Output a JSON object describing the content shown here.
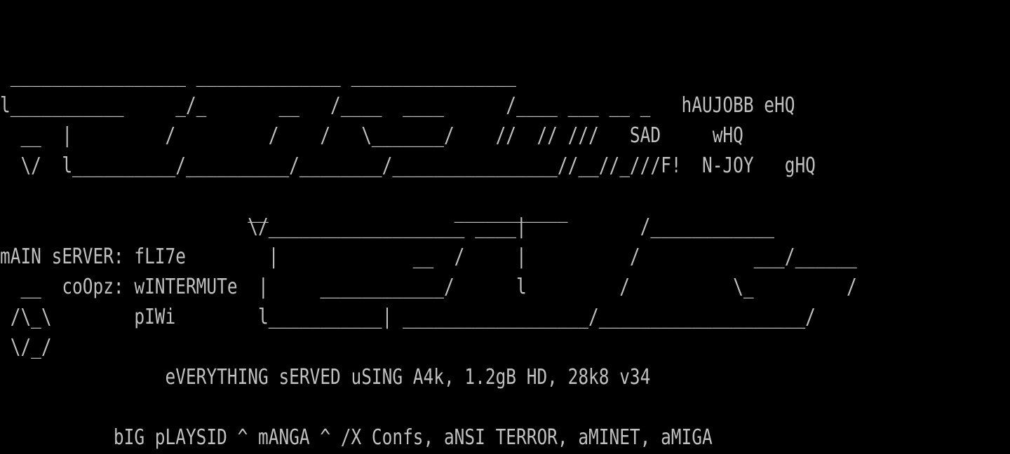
{
  "screen": {
    "foreground_color": "#c0c0c0",
    "background_color": "#000000",
    "lines": [
      "",
      "",
      " _________________ ______________ ________________",
      "l___________     _/_       __   /____  ____      /____ ___ __ _   hAUJOBB eHQ",
      "  __  |         /         /    /   \\_______/    //  // ///   SAD     wHQ",
      "  \\/  l__________/__________/________/________________//__//_///F!  N-JOY   gHQ",
      "",
      "                        __                  ___________",
      "                        \\/___________________ ____|           /____________",
      "mAIN sERVER: fLI7e        |             __  /     |          /           ___/______",
      "  __  coOpz: wINTERMUTe  |     ____________/      l         /          \\_         /",
      " /\\_\\        pIWi        l___________| __________________/____________________/",
      " \\/_/",
      "                eVERYTHING sERVED uSING A4k, 1.2gB HD, 28k8 v34",
      "",
      "           bIG pLAYSID ^ mANGA ^ /X Confs, aNSI TERROR, aMINET, aMIGA"
    ]
  }
}
